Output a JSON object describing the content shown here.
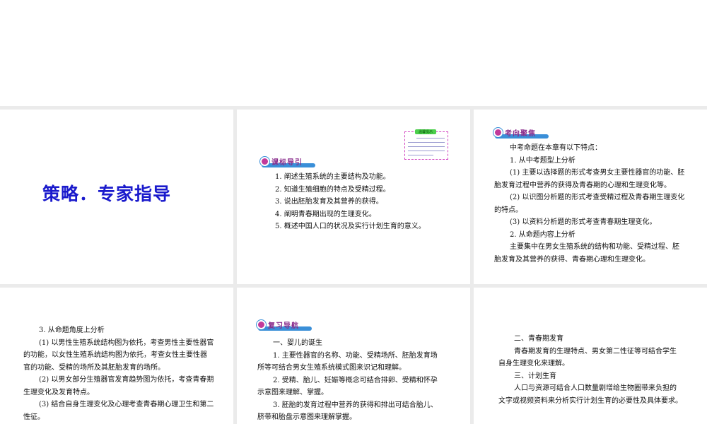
{
  "slide1": {
    "title": "策略．专家指导"
  },
  "slide2": {
    "badge": "课标导引",
    "tip_title": "温馨提示",
    "items": [
      "1. 阐述生殖系统的主要结构及功能。",
      "2. 知道生殖细胞的特点及受精过程。",
      "3. 说出胚胎发育及其营养的获得。",
      "4. 阐明青春期出现的生理变化。",
      "5. 概述中国人口的状况及实行计划生育的意义。"
    ]
  },
  "slide3": {
    "badge": "考向聚焦",
    "lines": [
      "中考命题在本章有以下特点：",
      "1. 从中考题型上分析",
      "(1) 主要以选择题的形式考查男女主要性器官的功能、胚",
      "胎发育过程中营养的获得及青春期的心理和生理变化等。",
      "(2) 以识图分析题的形式考查受精过程及青春期生理变化",
      "的特点。",
      "(3) 以资料分析题的形式考查青春期生理变化。",
      "2. 从命题内容上分析",
      "主要集中在男女生殖系统的结构和功能、受精过程、胚",
      "胎发育及其营养的获得、青春期心理和生理变化。"
    ]
  },
  "slide4": {
    "lines": [
      "3. 从命题角度上分析",
      "(1) 以男性生殖系统结构图为依托，考查男性主要性器官",
      "的功能，以女性生殖系统结构图为依托，考查女性主要性器",
      "官的功能、受精的场所及其胚胎发育的场所。",
      "(2) 以男女部分生殖器官发育趋势图为依托，考查青春期",
      "生理变化及发育特点。",
      "(3) 结合自身生理变化及心理考查青春期心理卫生和第二",
      "性征。"
    ]
  },
  "slide5": {
    "badge": "复习导航",
    "lines": [
      "一、婴儿的诞生",
      "1. 主要性器官的名称、功能、受精场所、胚胎发育场",
      "所等可结合男女生殖系统模式图来识记和理解。",
      "2. 受精、胎儿、妊娠等概念可结合排卵、受精和怀孕",
      "示意图来理解、掌握。",
      "3. 胚胎的发育过程中营养的获得和排出可结合胎儿、",
      "脐带和胎盘示意图来理解掌握。"
    ]
  },
  "slide6": {
    "lines": [
      "二、青春期发育",
      "青春期发育的生理特点、男女第二性征等可结合学生",
      "自身生理变化来理解。",
      "三、计划生育",
      "人口与资源可结合人口数量剧增给生物圈带来负担的",
      "文字或视频资料来分析实行计划生育的必要性及具体要求。"
    ]
  }
}
